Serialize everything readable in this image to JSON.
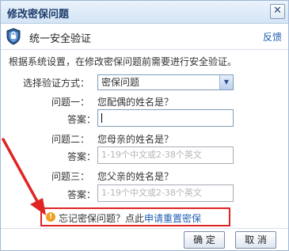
{
  "dialog": {
    "title": "修改密保问题",
    "close_glyph": "✕"
  },
  "security_bar": {
    "label": "统一安全验证",
    "feedback": "反馈"
  },
  "intro_text": "根据系统设置，在修改密保问题前需要进行安全验证。",
  "verify_method": {
    "label": "选择验证方式：",
    "selected": "密保问题"
  },
  "questions": [
    {
      "label": "问题一：",
      "question": "您配偶的姓名是？",
      "answer_label": "答案：",
      "answer_value": "",
      "placeholder": ""
    },
    {
      "label": "问题二：",
      "question": "您母亲的姓名是？",
      "answer_label": "答案：",
      "answer_value": "",
      "placeholder": "1-19个中文或2-38个英文"
    },
    {
      "label": "问题三：",
      "question": "您父亲的姓名是？",
      "answer_label": "答案：",
      "answer_value": "",
      "placeholder": "1-19个中文或2-38个英文"
    }
  ],
  "hint": {
    "text": "忘记密保问题？点此",
    "link": "申请重置密保"
  },
  "buttons": {
    "confirm": "确 定",
    "cancel": "取 消"
  },
  "colors": {
    "annotation_red": "#e02424",
    "link_blue": "#1f5fb4"
  }
}
